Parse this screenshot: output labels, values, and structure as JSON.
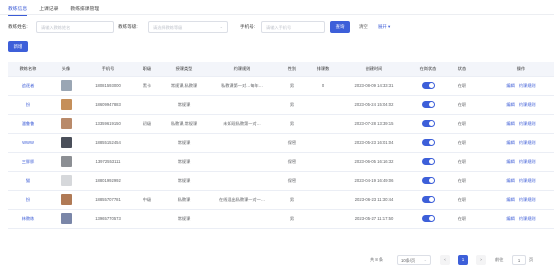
{
  "tabs": [
    {
      "label": "教练信息",
      "active": true
    },
    {
      "label": "上课记录",
      "active": false
    },
    {
      "label": "教练排课管理",
      "active": false
    }
  ],
  "filters": {
    "name_label": "教练姓名:",
    "name_placeholder": "请输入教练姓名",
    "level_label": "教练等级:",
    "level_placeholder": "请选择教练等级",
    "phone_label": "手机号:",
    "phone_placeholder": "请输入手机号",
    "search_label": "查询",
    "reset_label": "清空",
    "expand_label": "展开 ▾"
  },
  "add_label": "新增",
  "table": {
    "headers": [
      "教练名称",
      "头像",
      "手机号",
      "职级",
      "授课类型",
      "约课规则",
      "性别",
      "排课数",
      "创建时间",
      "在岗状态",
      "状态",
      "操作"
    ],
    "rows": [
      {
        "name": "追逐者",
        "phone": "18081593000",
        "level": "黑卡",
        "type": "常规课,私教课",
        "rule": "私教课第一对…每年…",
        "gender": "男",
        "count": "0",
        "created": "2023-08-09 14:33:31",
        "status": "在职",
        "avatar_color": "#9aa6b4"
      },
      {
        "name": "扮",
        "phone": "18609947883",
        "level": "",
        "type": "常规课",
        "rule": "",
        "gender": "男",
        "count": "",
        "created": "2023-05-24 15:04:02",
        "status": "在职",
        "avatar_color": "#c58f5a"
      },
      {
        "name": "潘鲁鲁",
        "phone": "13359619150",
        "level": "初级",
        "type": "私教课,常规课",
        "rule": "未如现私教第一对…",
        "gender": "男",
        "count": "",
        "created": "2023-07-28 13:39:15",
        "status": "在职",
        "avatar_color": "#b98a6a"
      },
      {
        "name": "WWW",
        "phone": "18855152454",
        "level": "",
        "type": "常规课",
        "rule": "",
        "gender": "保密",
        "count": "",
        "created": "2023-05-23 16:01:04",
        "status": "在职",
        "avatar_color": "#4a4f5a"
      },
      {
        "name": "三胖胖",
        "phone": "13972553111",
        "level": "",
        "type": "常规课",
        "rule": "",
        "gender": "保密",
        "count": "",
        "created": "2023-06-05 16:16:32",
        "status": "在职",
        "avatar_color": "#8c8f94"
      },
      {
        "name": "猫",
        "phone": "18801992992",
        "level": "",
        "type": "常规课",
        "rule": "",
        "gender": "保密",
        "count": "",
        "created": "2023-04-19 16:49:06",
        "status": "在职",
        "avatar_color": "#d6d8db"
      },
      {
        "name": "扮",
        "phone": "18855707781",
        "level": "中级",
        "type": "私教课",
        "rule": "在线混出私教课一对一…",
        "gender": "男",
        "count": "",
        "created": "2023-06-23 11:30:44",
        "status": "在职",
        "avatar_color": "#b07a56"
      },
      {
        "name": "林教练",
        "phone": "13965770573",
        "level": "",
        "type": "常规课",
        "rule": "",
        "gender": "男",
        "count": "",
        "created": "2023-05-27 11:17:50",
        "status": "在职",
        "avatar_color": "#7a86a8"
      }
    ],
    "ops": {
      "edit": "编辑",
      "rule": "约课规则"
    }
  },
  "pagination": {
    "total": "共 8 条",
    "page_size": "10条/页",
    "current_page": "1",
    "prev": "‹",
    "next": "›",
    "jump_label": "前往",
    "jump_value": "1",
    "page_unit": "页"
  },
  "colors": {
    "accent": "#3d5fd9",
    "header_bg": "#f3f5fa"
  }
}
